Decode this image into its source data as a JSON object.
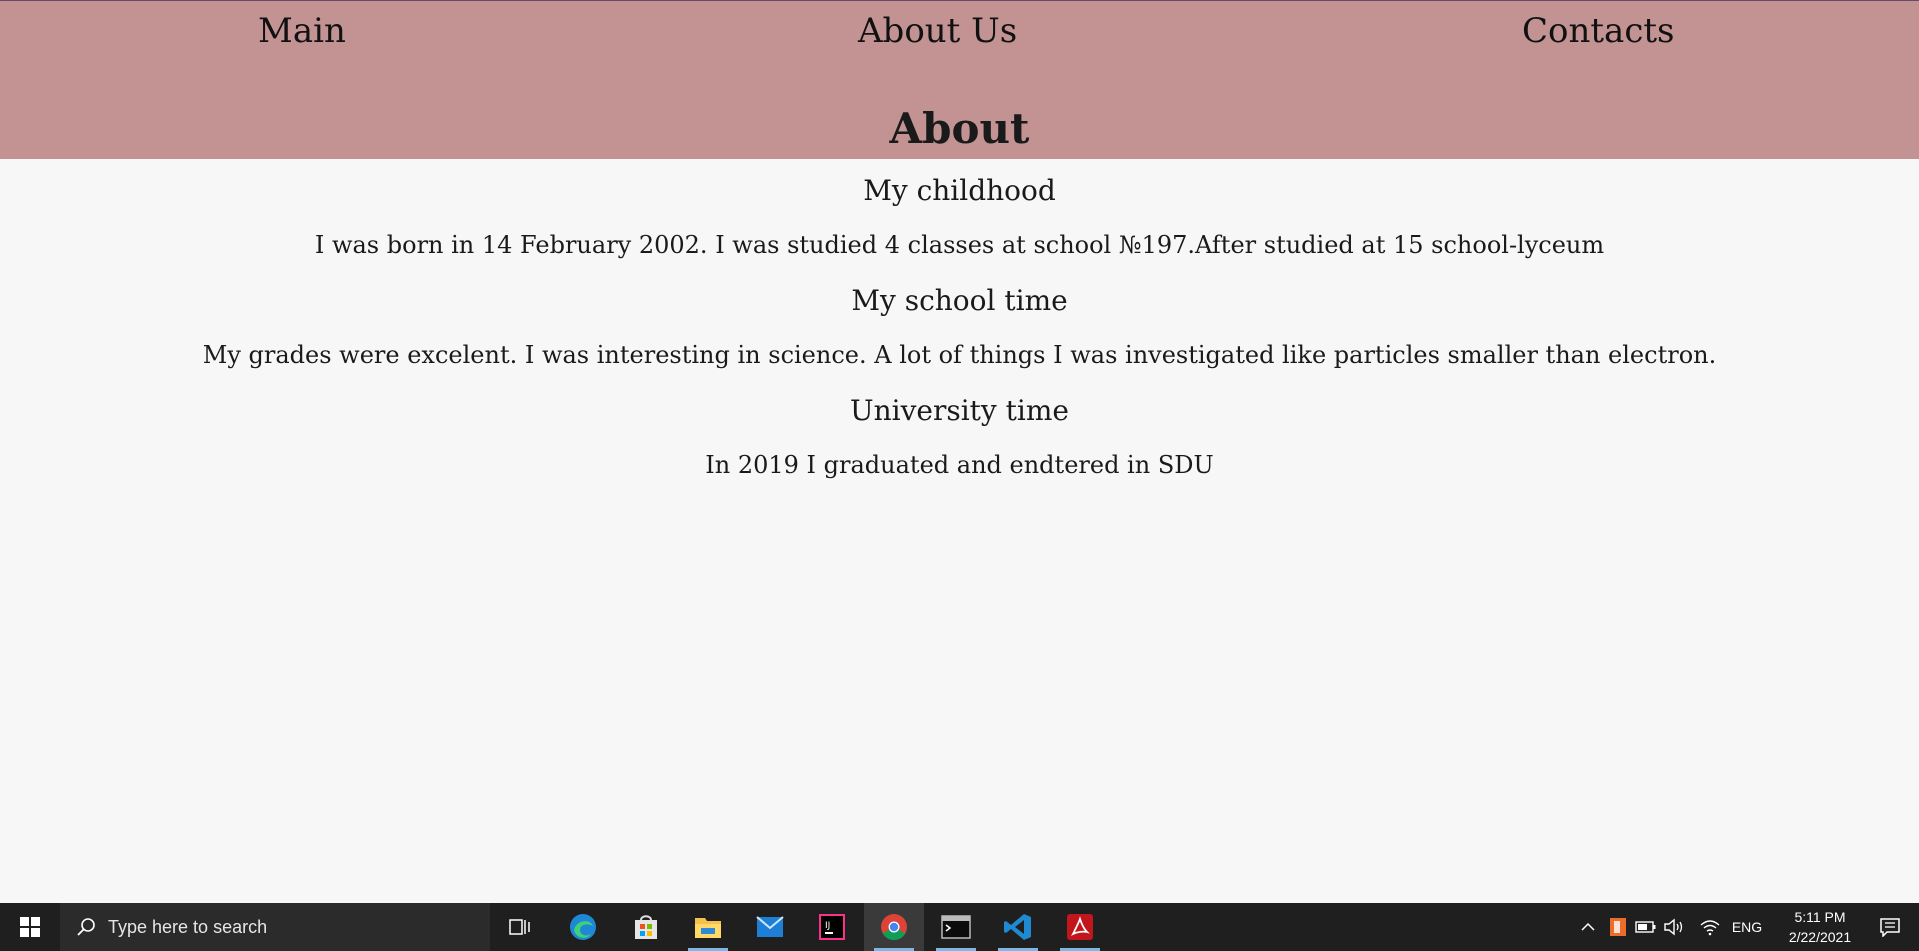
{
  "nav": {
    "main": "Main",
    "about_us": "About Us",
    "contacts": "Contacts"
  },
  "page_title": "About",
  "sections": [
    {
      "title": "My childhood",
      "text": "I was born in 14 February 2002. I was studied 4 classes at school №197.After studied at 15 school-lyceum"
    },
    {
      "title": "My school time",
      "text": "My grades were excelent. I was interesting in science. A lot of things I was investigated like particles smaller than electron."
    },
    {
      "title": "University time",
      "text": "In 2019 I graduated and endtered in SDU"
    }
  ],
  "colors": {
    "header_bg": "#c39393",
    "page_bg": "#f7f7f7",
    "taskbar_bg": "#1f1f1f"
  },
  "taskbar": {
    "search_placeholder": "Type here to search",
    "apps": [
      "task-view-icon",
      "edge-icon",
      "store-icon",
      "file-explorer-icon",
      "mail-icon",
      "intellij-icon",
      "chrome-icon",
      "terminal-icon",
      "vscode-icon",
      "acrobat-icon"
    ],
    "language": "ENG",
    "time": "5:11 PM",
    "date": "2/22/2021"
  }
}
